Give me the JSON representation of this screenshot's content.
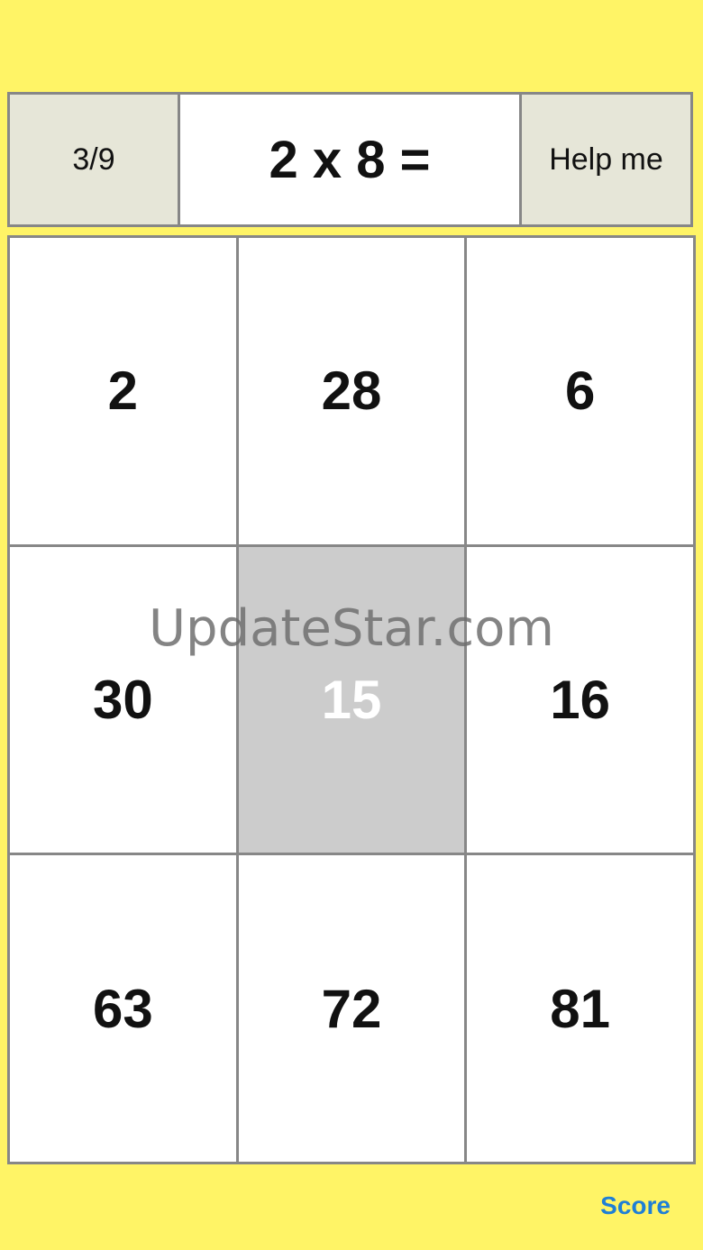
{
  "header": {
    "counter": "3/9",
    "question": "2 x 8 =",
    "help_label": "Help me"
  },
  "tiles": [
    "2",
    "28",
    "6",
    "30",
    "15",
    "16",
    "63",
    "72",
    "81"
  ],
  "selected_tile_index": 4,
  "watermark": "UpdateStar.com",
  "footer": {
    "score_label": "Score"
  },
  "colors": {
    "background": "#fff466",
    "header_side": "#e6e6d8",
    "selected_tile": "#cccccc",
    "link": "#1f7fd6",
    "border": "#878787"
  }
}
